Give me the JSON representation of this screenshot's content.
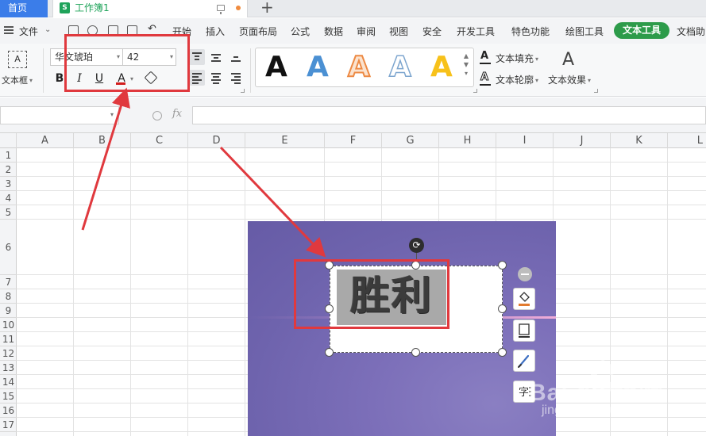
{
  "tabs": {
    "home": "首页",
    "document": "工作簿1"
  },
  "menu": {
    "file": "文件",
    "items": [
      "开始",
      "插入",
      "页面布局",
      "公式",
      "数据",
      "审阅",
      "视图",
      "安全",
      "开发工具",
      "特色功能",
      "绘图工具"
    ],
    "active": "文本工具",
    "overflow": "文档助"
  },
  "ribbon": {
    "textbox_label": "文本框",
    "textbox_icon": "A",
    "font_name": "华文琥珀",
    "font_size": "42",
    "bold": "B",
    "italic": "I",
    "underline": "U",
    "font_color": "A",
    "wordart_letter": "A",
    "text_fill": "文本填充",
    "text_outline": "文本轮廓",
    "text_effect": "文本效果"
  },
  "formula_bar": {
    "fx": "fx"
  },
  "sheet": {
    "columns": [
      "A",
      "B",
      "C",
      "D",
      "E",
      "F",
      "G",
      "H",
      "I",
      "J",
      "K",
      "L"
    ],
    "rows": [
      "1",
      "2",
      "3",
      "4",
      "5",
      "6",
      "7",
      "8",
      "9",
      "10",
      "11",
      "12",
      "13",
      "14",
      "15",
      "16",
      "17"
    ]
  },
  "textbox_content": "胜利",
  "watermark": {
    "brand": "Bai  du 经验",
    "url": "jingyan.baidu.com"
  },
  "colors": {
    "accent_blue": "#3b7de9",
    "active_tab_green": "#2d9b4a",
    "annotation_red": "#e0393e",
    "picture_purple": "#7368b3",
    "selection_gray": "#a9a9a9"
  }
}
